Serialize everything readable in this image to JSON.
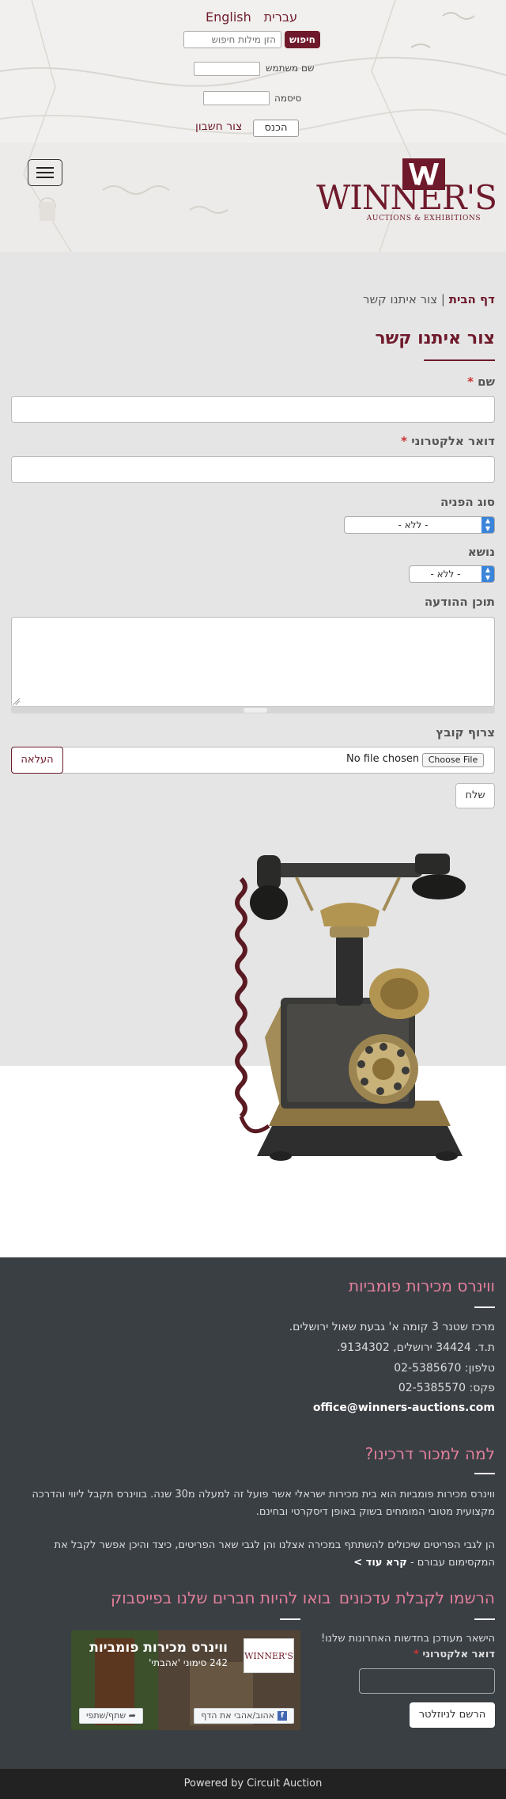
{
  "header": {
    "lang_english": "English",
    "lang_hebrew": "עברית",
    "search_button": "חיפוש",
    "search_placeholder": "הזן מילות חיפוש",
    "username_label": "שם משתמש",
    "password_label": "סיסמה",
    "login_button": "הכנס",
    "signup_link": "צור חשבון",
    "logo_name": "WINNER'S",
    "logo_tagline": "AUCTIONS & EXHIBITIONS"
  },
  "breadcrumb": {
    "home": "דף הבית",
    "separator": "|",
    "current": "צור איתנו קשר"
  },
  "page_title": "צור איתנו קשר",
  "form": {
    "name_label": "שם",
    "email_label": "דואר אלקטרוני",
    "required_mark": "*",
    "request_type_label": "סוג הפניה",
    "request_type_value": "- ללא -",
    "subject_label": "נושא",
    "subject_value": "- ללא -",
    "message_label": "תוכן ההודעה",
    "attach_label": "צרוף קובץ",
    "choose_file": "Choose File",
    "no_file": "No file chosen",
    "upload_button": "העלאה",
    "send_button": "שלח"
  },
  "footer": {
    "company_title": "ווינרס מכירות פומביות",
    "address_line": "מרכז שטנר 3 קומה א' גבעת שאול ירושלים.",
    "po_box": "ת.ד. 34424 ירושלים, 9134302.",
    "phone": "טלפון: 02-5385670",
    "fax": "פקס: 02-5385570",
    "email": "office@winners-auctions.com",
    "why_title": "למה למכור דרכינו?",
    "why_para1": "ווינרס מכירות פומביות הוא בית מכירות ישראלי אשר פועל זה למעלה מ30 שנה. בווינרס תקבל ליווי והדרכה מקצועית מטובי המומחים בשוק באופן דיסקרטי ובחינם.",
    "why_para2": "הן לגבי הפריטים שיכולים להשתתף במכירה אצלנו והן לגבי שאר הפריטים, כיצד והיכן אפשר לקבל את המקסימום עבורם -",
    "read_more": "קרא עוד >",
    "newsletter_title": "הרשמו לקבלת עדכונים",
    "newsletter_intro": "הישאר מעודכן בחדשות האחרונות שלנו!",
    "newsletter_email_label": "דואר אלקטרוני",
    "newsletter_button": "הרשם לניוזלטר",
    "facebook_title": "בואו להיות חברים שלנו בפייסבוק",
    "fb_page_name": "ווינרס מכירות פומביות",
    "fb_likes": "242 סימוני 'אהבתי'",
    "fb_like_button": "אהוב/אהבי את הדף",
    "fb_share_button": "שתף/שתפי"
  },
  "powered_by": "Powered by Circuit Auction",
  "colors": {
    "brand": "#6f1a2c",
    "footer_bg": "#3a3f44",
    "footer_heading": "#e37f9a",
    "select_arrow": "#3a84d9"
  }
}
